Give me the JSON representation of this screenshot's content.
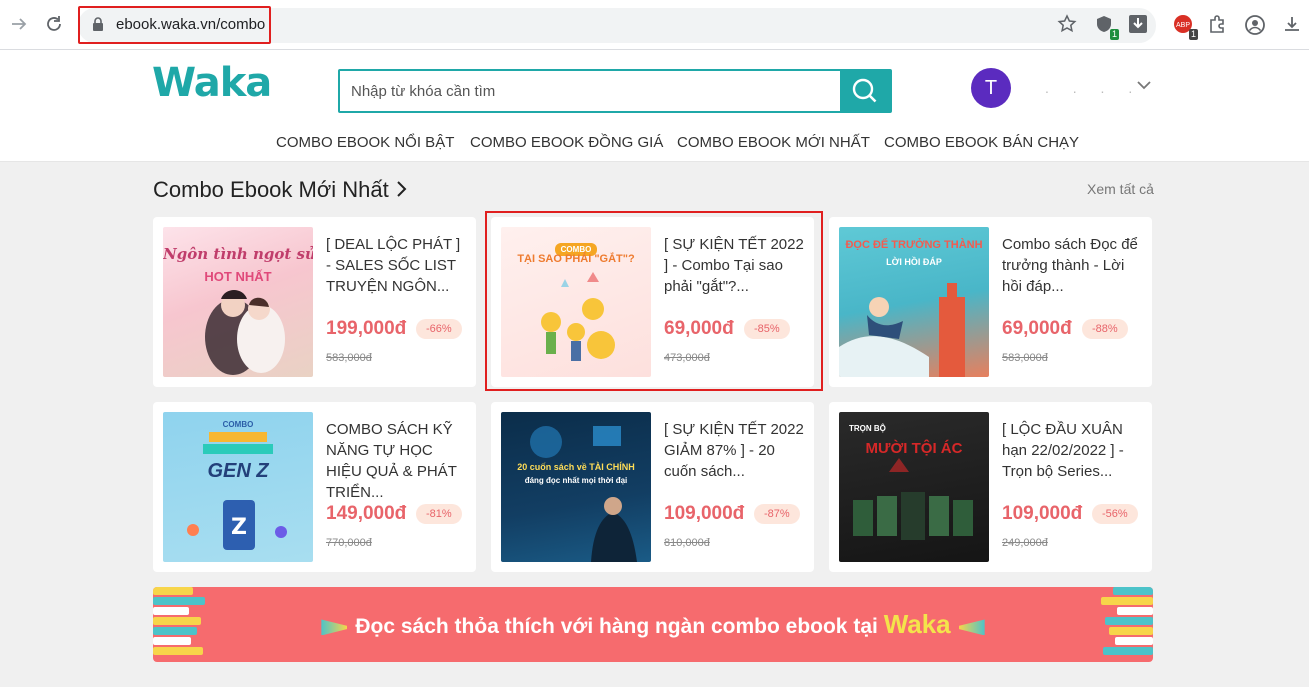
{
  "browser": {
    "url": "ebook.waka.vn/combo",
    "extensions": [
      {
        "name": "star-icon",
        "badge": ""
      },
      {
        "name": "shield-icon",
        "badge": "1"
      },
      {
        "name": "download-arrow-icon",
        "badge": ""
      },
      {
        "name": "adblock-icon",
        "badge": "1"
      },
      {
        "name": "puzzle-icon",
        "badge": ""
      },
      {
        "name": "profile-icon",
        "badge": ""
      },
      {
        "name": "download-icon",
        "badge": ""
      }
    ]
  },
  "header": {
    "logo": "Waka",
    "search_placeholder": "Nhập từ khóa cần tìm",
    "avatar_initial": "T",
    "user_name": ". . . .",
    "menu": [
      "COMBO EBOOK NỔI BẬT",
      "COMBO EBOOK ĐỒNG GIÁ",
      "COMBO EBOOK MỚI NHẤT",
      "COMBO EBOOK BÁN CHẠY"
    ]
  },
  "section": {
    "title": "Combo Ebook Mới Nhất",
    "see_all": "Xem tất cả"
  },
  "products": [
    {
      "name": "[ DEAL LỘC PHÁT ] - SALES SỐC LIST TRUYỆN NGÔN...",
      "price": "199,000đ",
      "discount": "-66%",
      "old_price": "583,000đ",
      "cover_text": "Ngôn tình ngọt sủng",
      "cover_sub": "HOT NHẤT"
    },
    {
      "name": "[ SỰ KIỆN TẾT 2022 ] - Combo Tại sao phải \"gắt\"?...",
      "price": "69,000đ",
      "discount": "-85%",
      "old_price": "473,000đ",
      "cover_text": "TẠI SAO PHẢI \"GẮT\"?",
      "cover_sub": "COMBO"
    },
    {
      "name": "Combo sách Đọc để trưởng thành - Lời hồi đáp...",
      "price": "69,000đ",
      "discount": "-88%",
      "old_price": "583,000đ",
      "cover_text": "ĐỌC ĐỂ TRƯỞNG THÀNH",
      "cover_sub": "LỜI HỒI ĐÁP"
    },
    {
      "name": "COMBO SÁCH KỸ NĂNG TỰ HỌC HIỆU QUẢ & PHÁT TRIỂN...",
      "price": "149,000đ",
      "discount": "-81%",
      "old_price": "770,000đ",
      "cover_text": "GEN Z",
      "cover_sub": "COMBO"
    },
    {
      "name": "[ SỰ KIỆN TẾT 2022 GIẢM 87% ] - 20 cuốn sách...",
      "price": "109,000đ",
      "discount": "-87%",
      "old_price": "810,000đ",
      "cover_text": "20 cuốn sách về TÀI CHÍNH",
      "cover_sub": "đáng đọc nhất mọi thời đại"
    },
    {
      "name": "[ LỘC ĐẦU XUÂN hạn 22/02/2022 ] - Trọn bộ Series...",
      "price": "109,000đ",
      "discount": "-56%",
      "old_price": "249,000đ",
      "cover_text": "MƯỜI TỘI ÁC",
      "cover_sub": "TRỌN BỘ"
    }
  ],
  "banner": {
    "text": "Đọc sách thỏa thích với hàng ngàn combo ebook tại",
    "brand": "Waka"
  },
  "colors": {
    "brand": "#1fa8a8",
    "price": "#e8646a",
    "highlight": "#e01f1f",
    "banner": "#f66b6e"
  }
}
